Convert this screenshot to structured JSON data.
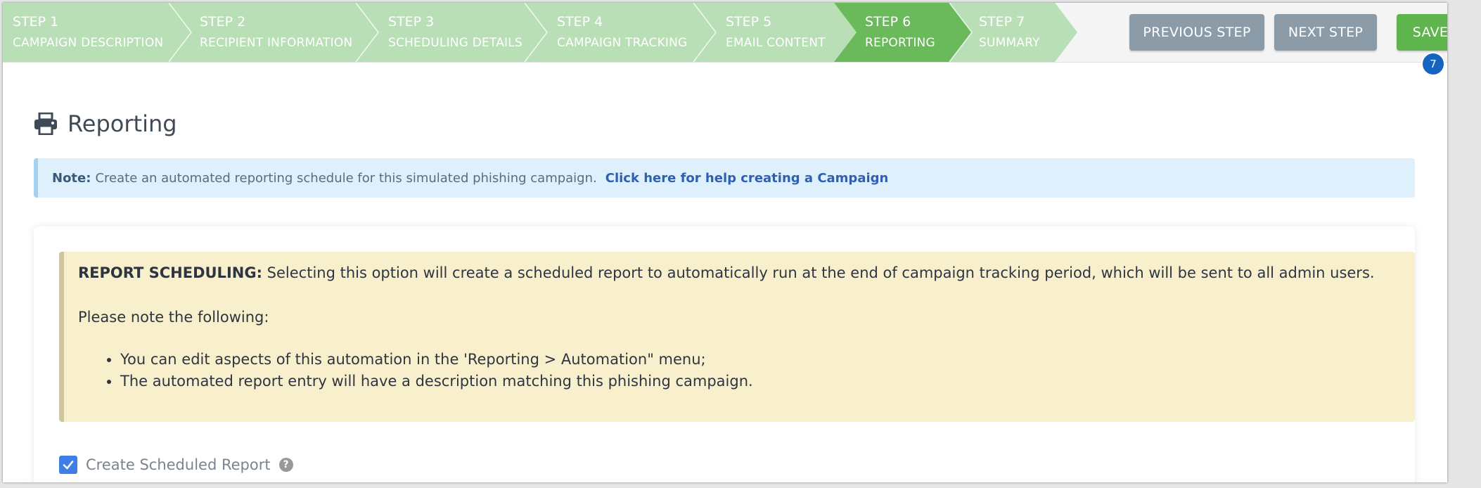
{
  "wizard": {
    "steps": [
      {
        "number": "STEP 1",
        "name": "CAMPAIGN DESCRIPTION"
      },
      {
        "number": "STEP 2",
        "name": "RECIPIENT INFORMATION"
      },
      {
        "number": "STEP 3",
        "name": "SCHEDULING DETAILS"
      },
      {
        "number": "STEP 4",
        "name": "CAMPAIGN TRACKING"
      },
      {
        "number": "STEP 5",
        "name": "EMAIL CONTENT"
      },
      {
        "number": "STEP 6",
        "name": "REPORTING"
      },
      {
        "number": "STEP 7",
        "name": "SUMMARY"
      }
    ],
    "active_step": 6,
    "colors": {
      "inactive": "#b9dfb7",
      "active": "#6aba5c",
      "bar": "#f4f4f4"
    }
  },
  "toolbar": {
    "previous_label": "PREVIOUS STEP",
    "next_label": "NEXT STEP",
    "save_label": "SAVE",
    "badge_count": "7",
    "colors": {
      "nav": "#8b9ba8",
      "save": "#5fb54d",
      "badge": "#1565c0"
    }
  },
  "page": {
    "title": "Reporting",
    "icon": "printer-icon"
  },
  "note": {
    "label": "Note:",
    "text": "Create an automated reporting schedule for this simulated phishing campaign.",
    "link": "Click here for help creating a Campaign"
  },
  "report_scheduling": {
    "heading": "REPORT SCHEDULING:",
    "text": "Selecting this option will create a scheduled report to automatically run at the end of campaign tracking period, which will be sent to all admin users.",
    "note_intro": "Please note the following:",
    "bullets": [
      "You can edit aspects of this automation in the 'Reporting > Automation\" menu;",
      "The automated report entry will have a description matching this phishing campaign."
    ]
  },
  "form": {
    "create_scheduled_report_label": "Create Scheduled Report",
    "create_scheduled_report_checked": true
  }
}
